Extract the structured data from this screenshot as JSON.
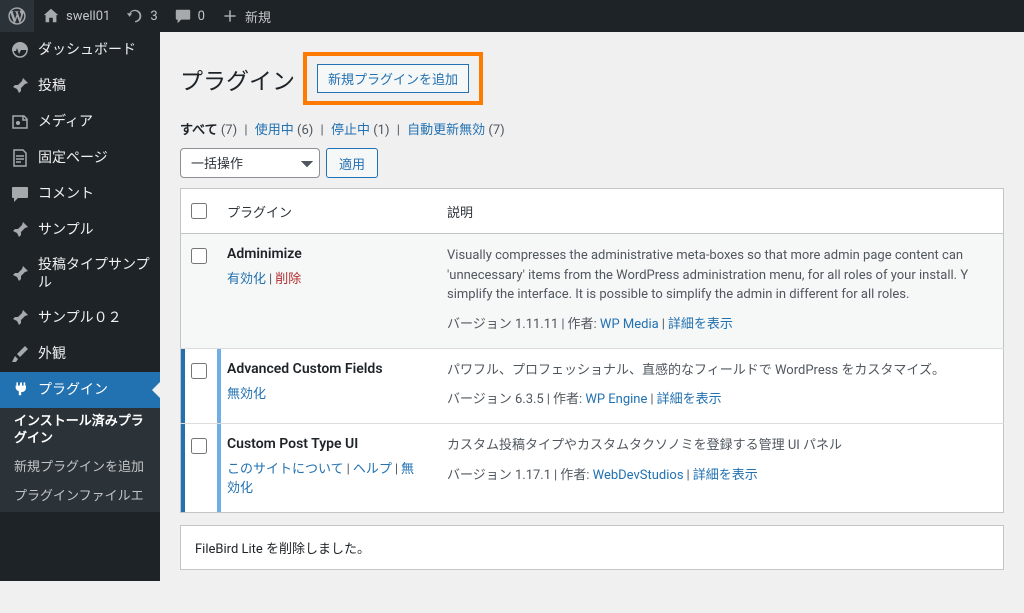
{
  "adminbar": {
    "site_name": "swell01",
    "updates_count": "3",
    "comments_count": "0",
    "new_label": "新規"
  },
  "sidebar": {
    "items": [
      {
        "icon": "dashboard",
        "label": "ダッシュボード"
      },
      {
        "icon": "pin",
        "label": "投稿"
      },
      {
        "icon": "media",
        "label": "メディア"
      },
      {
        "icon": "page",
        "label": "固定ページ"
      },
      {
        "icon": "comment",
        "label": "コメント"
      },
      {
        "icon": "pin",
        "label": "サンプル"
      },
      {
        "icon": "pin",
        "label": "投稿タイプサンプル"
      },
      {
        "icon": "pin",
        "label": "サンプル０２"
      },
      {
        "icon": "brush",
        "label": "外観"
      },
      {
        "icon": "plug",
        "label": "プラグイン"
      }
    ],
    "submenu": [
      "インストール済みプラグイン",
      "新規プラグインを追加",
      "プラグインファイルエ"
    ]
  },
  "page": {
    "title": "プラグイン",
    "add_new": "新規プラグインを追加"
  },
  "filters": {
    "all_label": "すべて",
    "all_count": "(7)",
    "active_label": "使用中",
    "active_count": "(6)",
    "inactive_label": "停止中",
    "inactive_count": "(1)",
    "autoupdate_label": "自動更新無効",
    "autoupdate_count": "(7)"
  },
  "bulk": {
    "placeholder": "一括操作",
    "apply": "適用"
  },
  "table": {
    "col_name": "プラグイン",
    "col_desc": "説明",
    "version_label": "バージョン",
    "author_label": "作者:",
    "details_label": "詳細を表示"
  },
  "plugins": [
    {
      "name": "Adminimize",
      "status": "inactive",
      "actions": [
        {
          "label": "有効化",
          "class": ""
        },
        {
          "label": "削除",
          "class": "del"
        }
      ],
      "description": "Visually compresses the administrative meta-boxes so that more admin page content can 'unnecessary' items from the WordPress administration menu, for all roles of your install. Y simplify the interface. It is possible to simplify the admin in different for all roles.",
      "version": "1.11.11",
      "author": "WP Media"
    },
    {
      "name": "Advanced Custom Fields",
      "status": "active",
      "actions": [
        {
          "label": "無効化",
          "class": ""
        }
      ],
      "description": "パワフル、プロフェッショナル、直感的なフィールドで WordPress をカスタマイズ。",
      "version": "6.3.5",
      "author": "WP Engine"
    },
    {
      "name": "Custom Post Type UI",
      "status": "active",
      "actions": [
        {
          "label": "このサイトについて",
          "class": ""
        },
        {
          "label": "ヘルプ",
          "class": ""
        },
        {
          "label": "無効化",
          "class": ""
        }
      ],
      "description": "カスタム投稿タイプやカスタムタクソノミを登録する管理 UI パネル",
      "version": "1.17.1",
      "author": "WebDevStudios"
    }
  ],
  "notice": "FileBird Lite を削除しました。"
}
